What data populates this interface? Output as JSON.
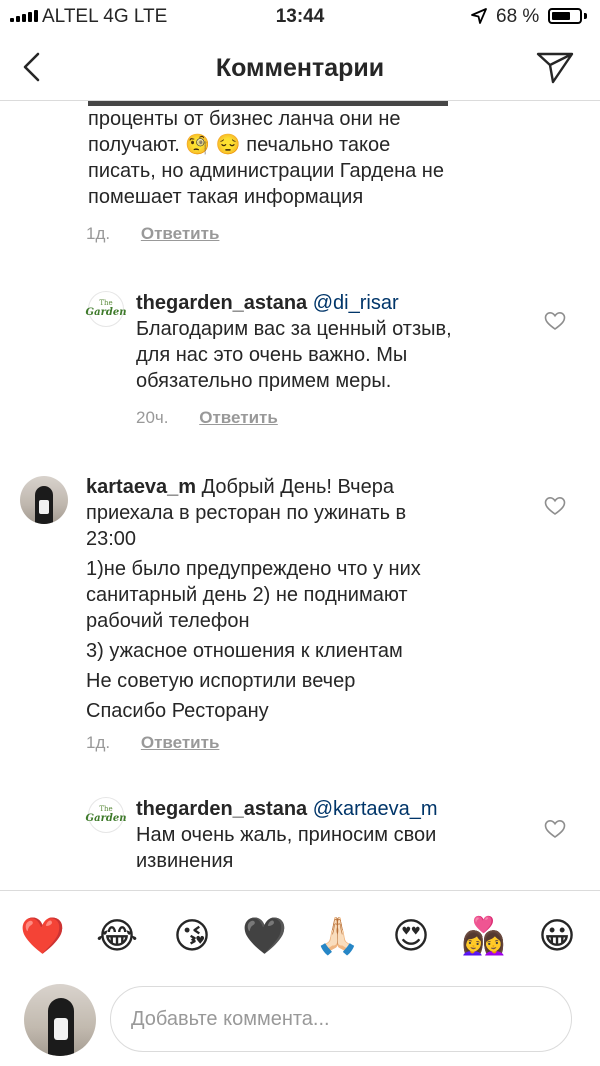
{
  "status_bar": {
    "carrier": "ALTEL 4G  LTE",
    "time": "13:44",
    "battery_percent": "68 %",
    "battery_level": 0.68
  },
  "header": {
    "title": "Комментарии"
  },
  "comments": [
    {
      "text": "проценты от бизнес ланча они не\nполучают. 🧐 😔  печально такое\nписать, но администрации Гардена не\nпомешает такая информация",
      "time": "1д.",
      "reply_label": "Ответить"
    },
    {
      "username": "thegarden_astana",
      "mention": "@di_risar",
      "text": "Благодарим вас за ценный отзыв,\nдля нас это очень важно. Мы\nобязательно примем меры.",
      "time": "20ч.",
      "reply_label": "Ответить",
      "logo_text": {
        "top": "The",
        "bottom": "Garden"
      }
    },
    {
      "username": "kartaeva_m",
      "lines": [
        "Добрый День! Вчера",
        "приехала в ресторан по ужинать в\n23:00",
        "1)не было  предупреждено что у них\nсанитарный день 2) не поднимают\nрабочий телефон",
        "3) ужасное отношения к клиентам",
        "Не советую испортили вечер",
        "Спасибо Ресторану"
      ],
      "time": "1д.",
      "reply_label": "Ответить"
    },
    {
      "username": "thegarden_astana",
      "mention": "@kartaeva_m",
      "text": "Нам очень жаль, приносим свои\nизвинения",
      "logo_text": {
        "top": "The",
        "bottom": "Garden"
      }
    }
  ],
  "emoji_bar": [
    "❤️",
    "😂",
    "😘",
    "🖤",
    "🙏🏻",
    "😍",
    "👩‍❤️‍👩",
    "😀"
  ],
  "input": {
    "placeholder": "Добавьте коммента..."
  },
  "icons": {
    "back": "chevron-left-icon",
    "send": "paper-plane-icon",
    "like": "heart-outline-icon",
    "location": "location-arrow-icon"
  }
}
